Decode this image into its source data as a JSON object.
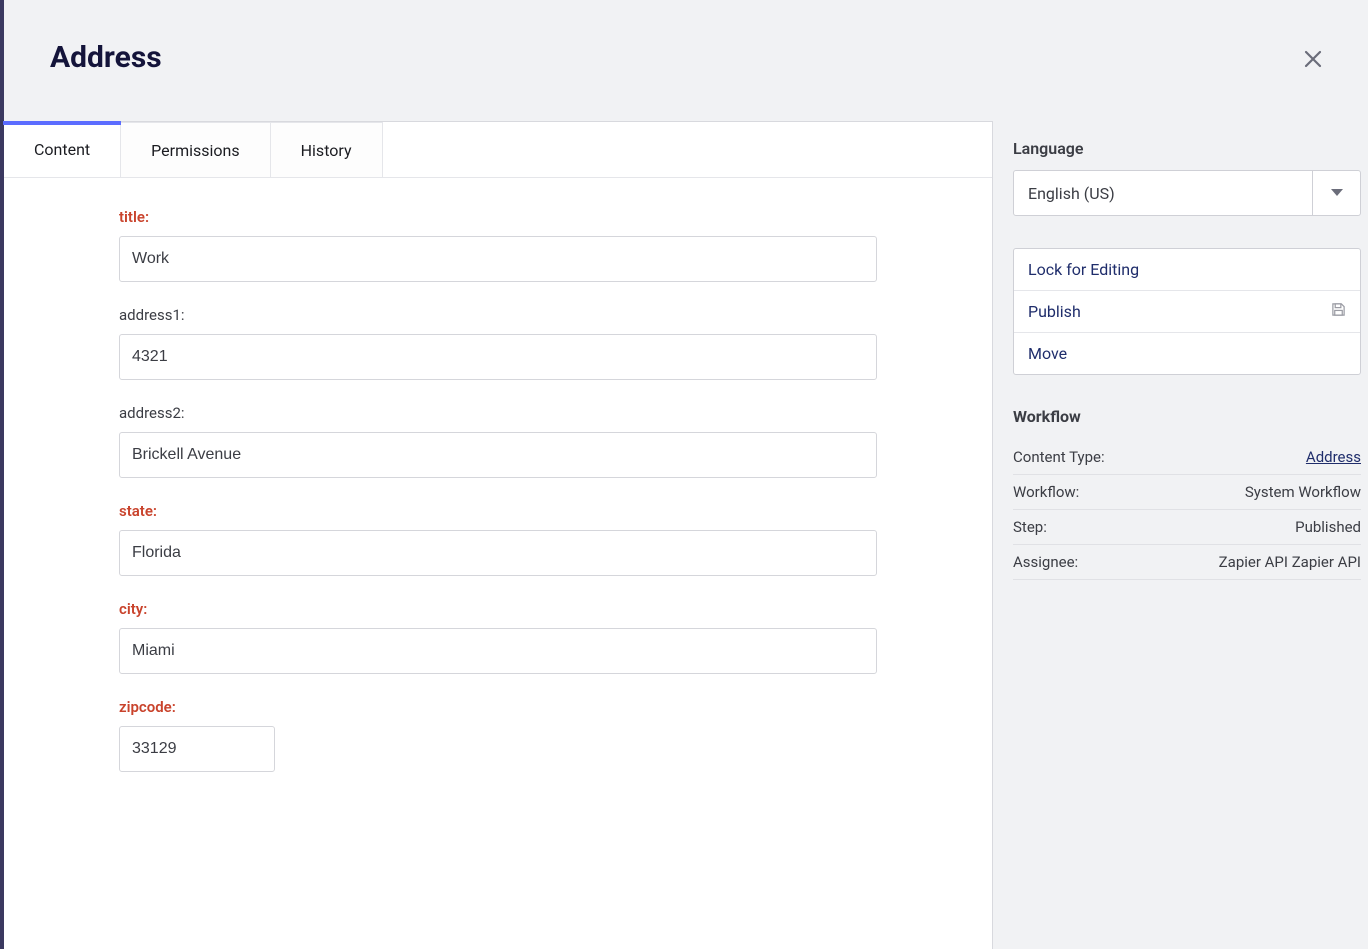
{
  "header": {
    "title": "Address"
  },
  "tabs": {
    "content": "Content",
    "permissions": "Permissions",
    "history": "History"
  },
  "form": {
    "title_label": "title:",
    "title_value": "Work",
    "address1_label": "address1:",
    "address1_value": "4321",
    "address2_label": "address2:",
    "address2_value": "Brickell Avenue",
    "state_label": "state:",
    "state_value": "Florida",
    "city_label": "city:",
    "city_value": "Miami",
    "zipcode_label": "zipcode:",
    "zipcode_value": "33129"
  },
  "sidebar": {
    "language_label": "Language",
    "language_value": "English (US)",
    "actions": {
      "lock": "Lock for Editing",
      "publish": "Publish",
      "move": "Move"
    },
    "workflow_title": "Workflow",
    "meta": {
      "content_type_key": "Content Type:",
      "content_type_val": "Address",
      "workflow_key": "Workflow:",
      "workflow_val": "System Workflow",
      "step_key": "Step:",
      "step_val": "Published",
      "assignee_key": "Assignee:",
      "assignee_val": "Zapier API Zapier API"
    }
  }
}
